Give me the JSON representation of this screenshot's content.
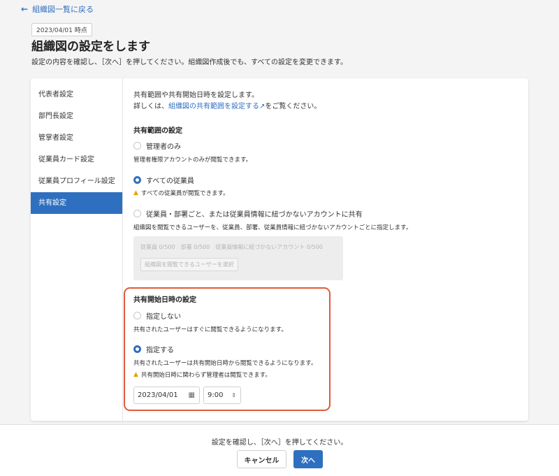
{
  "header": {
    "back_label": "組織図一覧に戻る",
    "date_badge": "2023/04/01 時点",
    "title": "組織図の設定をします",
    "subtitle": "設定の内容を確認し、［次へ］を押してください。組織図作成後でも、すべての設定を変更できます。"
  },
  "sidebar": {
    "items": [
      {
        "label": "代表者設定",
        "active": false
      },
      {
        "label": "部門長設定",
        "active": false
      },
      {
        "label": "管掌者設定",
        "active": false
      },
      {
        "label": "従業員カード設定",
        "active": false
      },
      {
        "label": "従業員プロフィール設定",
        "active": false
      },
      {
        "label": "共有設定",
        "active": true
      }
    ]
  },
  "content": {
    "intro": "共有範囲や共有開始日時を設定します。",
    "detail_prefix": "詳しくは、",
    "detail_link": "組織図の共有範囲を設定する",
    "detail_suffix": "をご覧ください。",
    "scope": {
      "heading": "共有範囲の設定",
      "options": [
        {
          "label": "管理者のみ",
          "desc": "管理者権限アカウントのみが閲覧できます。",
          "checked": false
        },
        {
          "label": "すべての従業員",
          "desc": "すべての従業員が閲覧できます。",
          "checked": true,
          "warning": true
        },
        {
          "label": "従業員・部署ごと、または従業員情報に紐づかないアカウントに共有",
          "desc": "組織図を閲覧できるユーザーを、従業員、部署、従業員情報に紐づかないアカウントごとに指定します。",
          "checked": false
        }
      ],
      "counts": "従業員 0/500　部署 0/500　従業員情報に紐づかないアカウント 0/500",
      "select_button": "組織図を閲覧できるユーザーを選択"
    },
    "start": {
      "heading": "共有開始日時の設定",
      "options": [
        {
          "label": "指定しない",
          "desc": "共有されたユーザーはすぐに閲覧できるようになります。",
          "checked": false
        },
        {
          "label": "指定する",
          "desc": "共有されたユーザーは共有開始日時から閲覧できるようになります。",
          "checked": true
        }
      ],
      "warning": "共有開始日時に関わらず管理者は閲覧できます。",
      "date_value": "2023/04/01",
      "time_value": "9:00"
    }
  },
  "footer": {
    "message": "設定を確認し、［次へ］を押してください。",
    "cancel_label": "キャンセル",
    "next_label": "次へ"
  },
  "colors": {
    "accent": "#2f6fbf",
    "highlight": "#e05a3a",
    "warning": "#e6a100"
  }
}
